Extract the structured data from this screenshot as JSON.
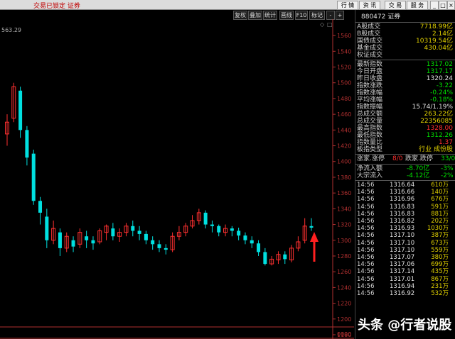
{
  "title": "交易已锁定 证券",
  "top_buttons": [
    "行 情",
    "资 讯",
    "交 易",
    "服 务"
  ],
  "toolbar_buttons": [
    "复权",
    "叠加",
    "统计",
    "画线",
    "F10",
    "标记",
    "-",
    "+"
  ],
  "ref_price": "563.29",
  "axis_labels": [
    "1560",
    "1540",
    "1520",
    "1500",
    "1480",
    "1460",
    "1440",
    "1420",
    "1400",
    "1380",
    "1360",
    "1340",
    "1320",
    "1300",
    "1280",
    "1260",
    "1240",
    "1220",
    "1200",
    "1180",
    "0000"
  ],
  "colors": {
    "up": "#ff3030",
    "down": "#00e0e0",
    "yellow": "#e0d000",
    "red_arrow": "#ff2020"
  },
  "chart_data": {
    "type": "candlestick",
    "ylim": [
      1180,
      1570
    ],
    "candles": [
      [
        1435,
        1450,
        1420,
        1460
      ],
      [
        1455,
        1495,
        1450,
        1500
      ],
      [
        1490,
        1440,
        1430,
        1495
      ],
      [
        1440,
        1405,
        1395,
        1445
      ],
      [
        1410,
        1350,
        1345,
        1415
      ],
      [
        1350,
        1335,
        1320,
        1355
      ],
      [
        1330,
        1300,
        1290,
        1340
      ],
      [
        1300,
        1315,
        1295,
        1325
      ],
      [
        1310,
        1290,
        1280,
        1315
      ],
      [
        1290,
        1305,
        1285,
        1310
      ],
      [
        1300,
        1292,
        1285,
        1305
      ],
      [
        1295,
        1310,
        1290,
        1315
      ],
      [
        1305,
        1300,
        1290,
        1312
      ],
      [
        1300,
        1296,
        1288,
        1305
      ],
      [
        1298,
        1312,
        1295,
        1315
      ],
      [
        1310,
        1318,
        1300,
        1320
      ],
      [
        1315,
        1305,
        1300,
        1322
      ],
      [
        1305,
        1310,
        1298,
        1315
      ],
      [
        1310,
        1318,
        1305,
        1322
      ],
      [
        1318,
        1312,
        1305,
        1325
      ],
      [
        1312,
        1308,
        1300,
        1318
      ],
      [
        1308,
        1300,
        1295,
        1312
      ],
      [
        1300,
        1295,
        1288,
        1305
      ],
      [
        1295,
        1290,
        1285,
        1300
      ],
      [
        1290,
        1288,
        1282,
        1295
      ],
      [
        1288,
        1305,
        1285,
        1310
      ],
      [
        1305,
        1310,
        1300,
        1318
      ],
      [
        1310,
        1318,
        1305,
        1322
      ],
      [
        1318,
        1325,
        1315,
        1332
      ],
      [
        1325,
        1335,
        1320,
        1340
      ],
      [
        1335,
        1320,
        1315,
        1338
      ],
      [
        1320,
        1318,
        1310,
        1325
      ],
      [
        1318,
        1310,
        1305,
        1320
      ],
      [
        1310,
        1315,
        1305,
        1320
      ],
      [
        1315,
        1312,
        1305,
        1318
      ],
      [
        1312,
        1306,
        1300,
        1316
      ],
      [
        1306,
        1300,
        1295,
        1310
      ],
      [
        1300,
        1296,
        1290,
        1305
      ],
      [
        1296,
        1285,
        1280,
        1300
      ],
      [
        1285,
        1270,
        1268,
        1290
      ],
      [
        1270,
        1276,
        1268,
        1280
      ],
      [
        1275,
        1282,
        1270,
        1286
      ],
      [
        1282,
        1276,
        1270,
        1286
      ],
      [
        1275,
        1290,
        1272,
        1294
      ],
      [
        1290,
        1298,
        1286,
        1305
      ],
      [
        1300,
        1318,
        1296,
        1328
      ],
      [
        1318,
        1316,
        1312,
        1328
      ]
    ]
  },
  "panel": {
    "code": "880472 证券",
    "volume_rows": [
      {
        "k": "A股成交",
        "v": "7718.99亿",
        "c": "#e0d000"
      },
      {
        "k": "B股成交",
        "v": "2.14亿",
        "c": "#e0d000"
      },
      {
        "k": "国债成交",
        "v": "10319.54亿",
        "c": "#e0d000"
      },
      {
        "k": "基金成交",
        "v": "430.04亿",
        "c": "#e0d000"
      },
      {
        "k": "权证成交",
        "v": "",
        "c": "#e0d000"
      }
    ],
    "stat_rows": [
      {
        "k": "最新指数",
        "v": "1317.02",
        "c": "#00e000"
      },
      {
        "k": "今日开盘",
        "v": "1317.17",
        "c": "#00e000"
      },
      {
        "k": "昨日收盘",
        "v": "1320.24",
        "c": "#e0e0e0"
      },
      {
        "k": "指数涨跌",
        "v": "-3.22",
        "c": "#00e000"
      },
      {
        "k": "指数涨幅",
        "v": "-0.24%",
        "c": "#00e000"
      },
      {
        "k": "平均涨幅",
        "v": "-0.18%",
        "c": "#00e000"
      },
      {
        "k": "指数振幅",
        "v": "15.74/1.19%",
        "c": "#e0e0e0"
      },
      {
        "k": "总成交额",
        "v": "263.22亿",
        "c": "#e0d000"
      },
      {
        "k": "总成交量",
        "v": "22356085",
        "c": "#e0d000"
      },
      {
        "k": "最高指数",
        "v": "1328.00",
        "c": "#ff3030"
      },
      {
        "k": "最低指数",
        "v": "1312.26",
        "c": "#00e000"
      },
      {
        "k": "指数量比",
        "v": "1.37",
        "c": "#ff3030"
      },
      {
        "k": "板指类型",
        "v": "行业 成份股",
        "c": "#e0d000"
      }
    ],
    "updown": {
      "k1": "涨家.涨停",
      "v1": "8/0",
      "k2": "跌家.跌停",
      "v2": "33/0"
    },
    "flow_rows": [
      {
        "k": "净流入额",
        "v1": "-8.70亿",
        "v2": "-3%"
      },
      {
        "k": "大宗流入",
        "v1": "-4.12亿",
        "v2": "-2%"
      }
    ],
    "ticks": [
      {
        "t": "14:56",
        "p": "1316.64",
        "v": "610万"
      },
      {
        "t": "14:56",
        "p": "1316.66",
        "v": "140万"
      },
      {
        "t": "14:56",
        "p": "1316.96",
        "v": "676万"
      },
      {
        "t": "14:56",
        "p": "1316.83",
        "v": "591万"
      },
      {
        "t": "14:56",
        "p": "1316.83",
        "v": "881万"
      },
      {
        "t": "14:56",
        "p": "1316.82",
        "v": "202万"
      },
      {
        "t": "14:56",
        "p": "1316.93",
        "v": "1030万"
      },
      {
        "t": "14:56",
        "p": "1317.10",
        "v": "387万"
      },
      {
        "t": "14:56",
        "p": "1317.10",
        "v": "673万"
      },
      {
        "t": "14:56",
        "p": "1317.10",
        "v": "559万"
      },
      {
        "t": "14:56",
        "p": "1317.07",
        "v": "380万"
      },
      {
        "t": "14:56",
        "p": "1317.06",
        "v": "699万"
      },
      {
        "t": "14:56",
        "p": "1317.14",
        "v": "435万"
      },
      {
        "t": "14:56",
        "p": "1317.01",
        "v": "867万"
      },
      {
        "t": "14:56",
        "p": "1316.94",
        "v": "231万"
      },
      {
        "t": "14:56",
        "p": "1316.92",
        "v": "532万"
      }
    ]
  },
  "watermark": "头条 @行者说股"
}
